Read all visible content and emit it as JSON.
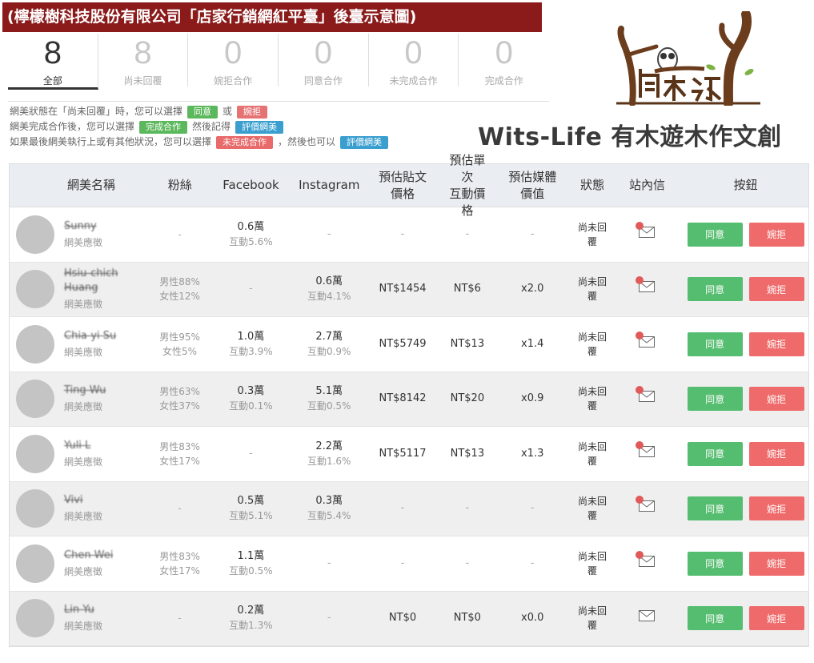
{
  "banner": "(檸檬樹科技股份有限公司「店家行銷網紅平臺」後臺示意圖)",
  "stats": [
    {
      "num": "8",
      "label": "全部",
      "active": true
    },
    {
      "num": "8",
      "label": "尚未回覆"
    },
    {
      "num": "0",
      "label": "婉拒合作"
    },
    {
      "num": "0",
      "label": "同意合作"
    },
    {
      "num": "0",
      "label": "未完成合作"
    },
    {
      "num": "0",
      "label": "完成合作"
    }
  ],
  "instructions": {
    "line1_a": "網美狀態在「尚未回覆」時，您可以選擇",
    "line1_tag1": "同意",
    "line1_or": "或",
    "line1_tag2": "婉拒",
    "line2_a": "網美完成合作後，您可以選擇",
    "line2_tag1": "完成合作",
    "line2_b": "然後記得",
    "line2_tag2": "評價網美",
    "line3_a": "如果最後網美執行上或有其他狀況，您可以選擇",
    "line3_tag1": "未完成合作",
    "line3_b": "，然後也可以",
    "line3_tag2": "評價網美"
  },
  "logo_text": "有木遊",
  "brand": "Wits-Life 有木遊木作文創",
  "table": {
    "headers": {
      "name": "網美名稱",
      "fans": "粉絲",
      "fb": "Facebook",
      "ig": "Instagram",
      "post_l1": "預估貼文",
      "post_l2": "價格",
      "inter_l1": "預估單次",
      "inter_l2": "互動價格",
      "media_l1": "預估媒體",
      "media_l2": "價值",
      "status": "狀態",
      "msg": "站內信",
      "btn": "按鈕"
    },
    "rows": [
      {
        "name": "Sunny",
        "sub": "網美應徵",
        "fans1": "-",
        "fans2": "",
        "fb1": "0.6萬",
        "fb2": "互動5.6%",
        "ig1": "-",
        "ig2": "",
        "post": "-",
        "inter": "-",
        "media": "-",
        "status": "尚未回覆",
        "unread": true,
        "agree": "同意",
        "reject": "婉拒"
      },
      {
        "name": "Hsiu-chich Huang",
        "sub": "網美應徵",
        "fans1": "男性88%",
        "fans2": "女性12%",
        "fb1": "-",
        "fb2": "",
        "ig1": "0.6萬",
        "ig2": "互動4.1%",
        "post": "NT$1454",
        "inter": "NT$6",
        "media": "x2.0",
        "status": "尚未回覆",
        "unread": true,
        "agree": "同意",
        "reject": "婉拒"
      },
      {
        "name": "Chia-yi Su",
        "sub": "網美應徵",
        "fans1": "男性95%",
        "fans2": "女性5%",
        "fb1": "1.0萬",
        "fb2": "互動3.9%",
        "ig1": "2.7萬",
        "ig2": "互動0.9%",
        "post": "NT$5749",
        "inter": "NT$13",
        "media": "x1.4",
        "status": "尚未回覆",
        "unread": true,
        "agree": "同意",
        "reject": "婉拒"
      },
      {
        "name": "Ting Wu",
        "sub": "網美應徵",
        "fans1": "男性63%",
        "fans2": "女性37%",
        "fb1": "0.3萬",
        "fb2": "互動0.1%",
        "ig1": "5.1萬",
        "ig2": "互動0.5%",
        "post": "NT$8142",
        "inter": "NT$20",
        "media": "x0.9",
        "status": "尚未回覆",
        "unread": true,
        "agree": "同意",
        "reject": "婉拒"
      },
      {
        "name": "Yuli L",
        "sub": "網美應徵",
        "fans1": "男性83%",
        "fans2": "女性17%",
        "fb1": "-",
        "fb2": "",
        "ig1": "2.2萬",
        "ig2": "互動1.6%",
        "post": "NT$5117",
        "inter": "NT$13",
        "media": "x1.3",
        "status": "尚未回覆",
        "unread": true,
        "agree": "同意",
        "reject": "婉拒"
      },
      {
        "name": "Vivi",
        "sub": "網美應徵",
        "fans1": "-",
        "fans2": "",
        "fb1": "0.5萬",
        "fb2": "互動5.1%",
        "ig1": "0.3萬",
        "ig2": "互動5.4%",
        "post": "-",
        "inter": "-",
        "media": "-",
        "status": "尚未回覆",
        "unread": true,
        "agree": "同意",
        "reject": "婉拒"
      },
      {
        "name": "Chen Wei",
        "sub": "網美應徵",
        "fans1": "男性83%",
        "fans2": "女性17%",
        "fb1": "1.1萬",
        "fb2": "互動0.5%",
        "ig1": "-",
        "ig2": "",
        "post": "-",
        "inter": "-",
        "media": "-",
        "status": "尚未回覆",
        "unread": true,
        "agree": "同意",
        "reject": "婉拒"
      },
      {
        "name": "Lin Yu",
        "sub": "網美應徵",
        "fans1": "-",
        "fans2": "",
        "fb1": "0.2萬",
        "fb2": "互動1.3%",
        "ig1": "-",
        "ig2": "",
        "post": "NT$0",
        "inter": "NT$0",
        "media": "x0.0",
        "status": "尚未回覆",
        "unread": false,
        "agree": "同意",
        "reject": "婉拒"
      }
    ]
  }
}
